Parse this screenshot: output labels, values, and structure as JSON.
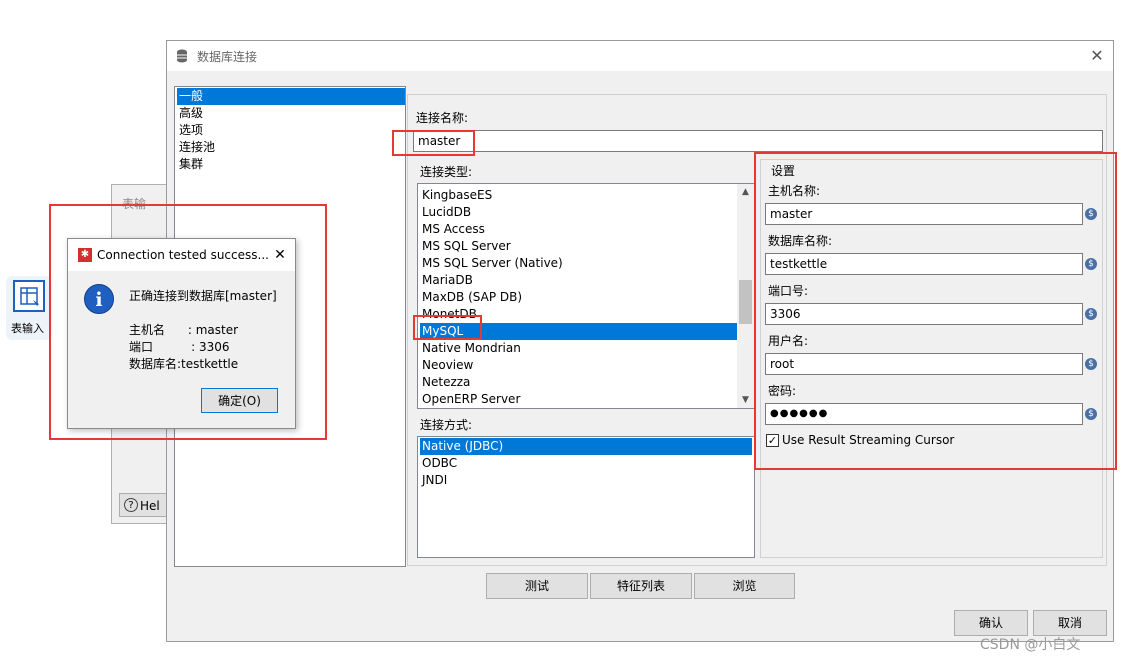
{
  "background_step": {
    "label": "表输入"
  },
  "bg_dialog": {
    "title_partial": "表输",
    "help_partial": "Hel"
  },
  "main_dialog": {
    "title": "数据库连接",
    "left_tabs": [
      "一般",
      "高级",
      "选项",
      "连接池",
      "集群"
    ],
    "connection_name_label": "连接名称:",
    "connection_name_value": "master",
    "connection_type_label": "连接类型:",
    "connection_types": [
      "KingbaseES",
      "LucidDB",
      "MS Access",
      "MS SQL Server",
      "MS SQL Server (Native)",
      "MariaDB",
      "MaxDB (SAP DB)",
      "MonetDB",
      "MySQL",
      "Native Mondrian",
      "Neoview",
      "Netezza",
      "OpenERP Server"
    ],
    "selected_type": "MySQL",
    "access_label": "连接方式:",
    "access_methods": [
      "Native (JDBC)",
      "ODBC",
      "JNDI"
    ],
    "settings": {
      "group_label": "设置",
      "host_label": "主机名称:",
      "host_value": "master",
      "db_label": "数据库名称:",
      "db_value": "testkettle",
      "port_label": "端口号:",
      "port_value": "3306",
      "user_label": "用户名:",
      "user_value": "root",
      "password_label": "密码:",
      "password_value": "●●●●●●",
      "streaming_label": "Use Result Streaming Cursor",
      "streaming_checked": true
    },
    "buttons": {
      "test": "测试",
      "features": "特征列表",
      "browse": "浏览",
      "ok": "确认",
      "cancel": "取消"
    }
  },
  "popup": {
    "title": "Connection tested success...",
    "message": "正确连接到数据库[master]",
    "host_line": "主机名      : master",
    "port_line": "端口          : 3306",
    "db_line": "数据库名:testkettle",
    "ok_button": "确定(O)"
  },
  "watermark": "CSDN @小白文",
  "colors": {
    "selection": "#0078d7",
    "highlight_box": "#e53935",
    "popup_icon": "#1f5fbf"
  }
}
